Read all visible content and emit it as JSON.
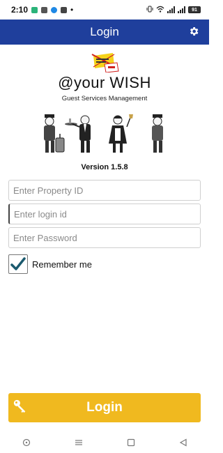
{
  "status_bar": {
    "time": "2:10",
    "dot": "•",
    "battery": "91"
  },
  "app_bar": {
    "title": "Login",
    "settings_icon": "gear-icon"
  },
  "logo": {
    "brand": "@your WISH",
    "tagline": "Guest Services Management",
    "stamp_icon": "first-stamp-logo"
  },
  "version": "Version 1.5.8",
  "form": {
    "property_placeholder": "Enter Property ID",
    "login_placeholder": "Enter login id",
    "password_placeholder": "Enter Password",
    "remember_label": "Remember me",
    "remember_checked": true
  },
  "login_button": {
    "label": "Login",
    "icon": "key-icon"
  },
  "nav": {
    "icons": [
      "circle-icon",
      "menu-icon",
      "square-icon",
      "back-triangle-icon"
    ]
  },
  "colors": {
    "app_bar": "#1f3f9c",
    "login_button": "#f0b91f",
    "check": "#1b5a6e"
  }
}
